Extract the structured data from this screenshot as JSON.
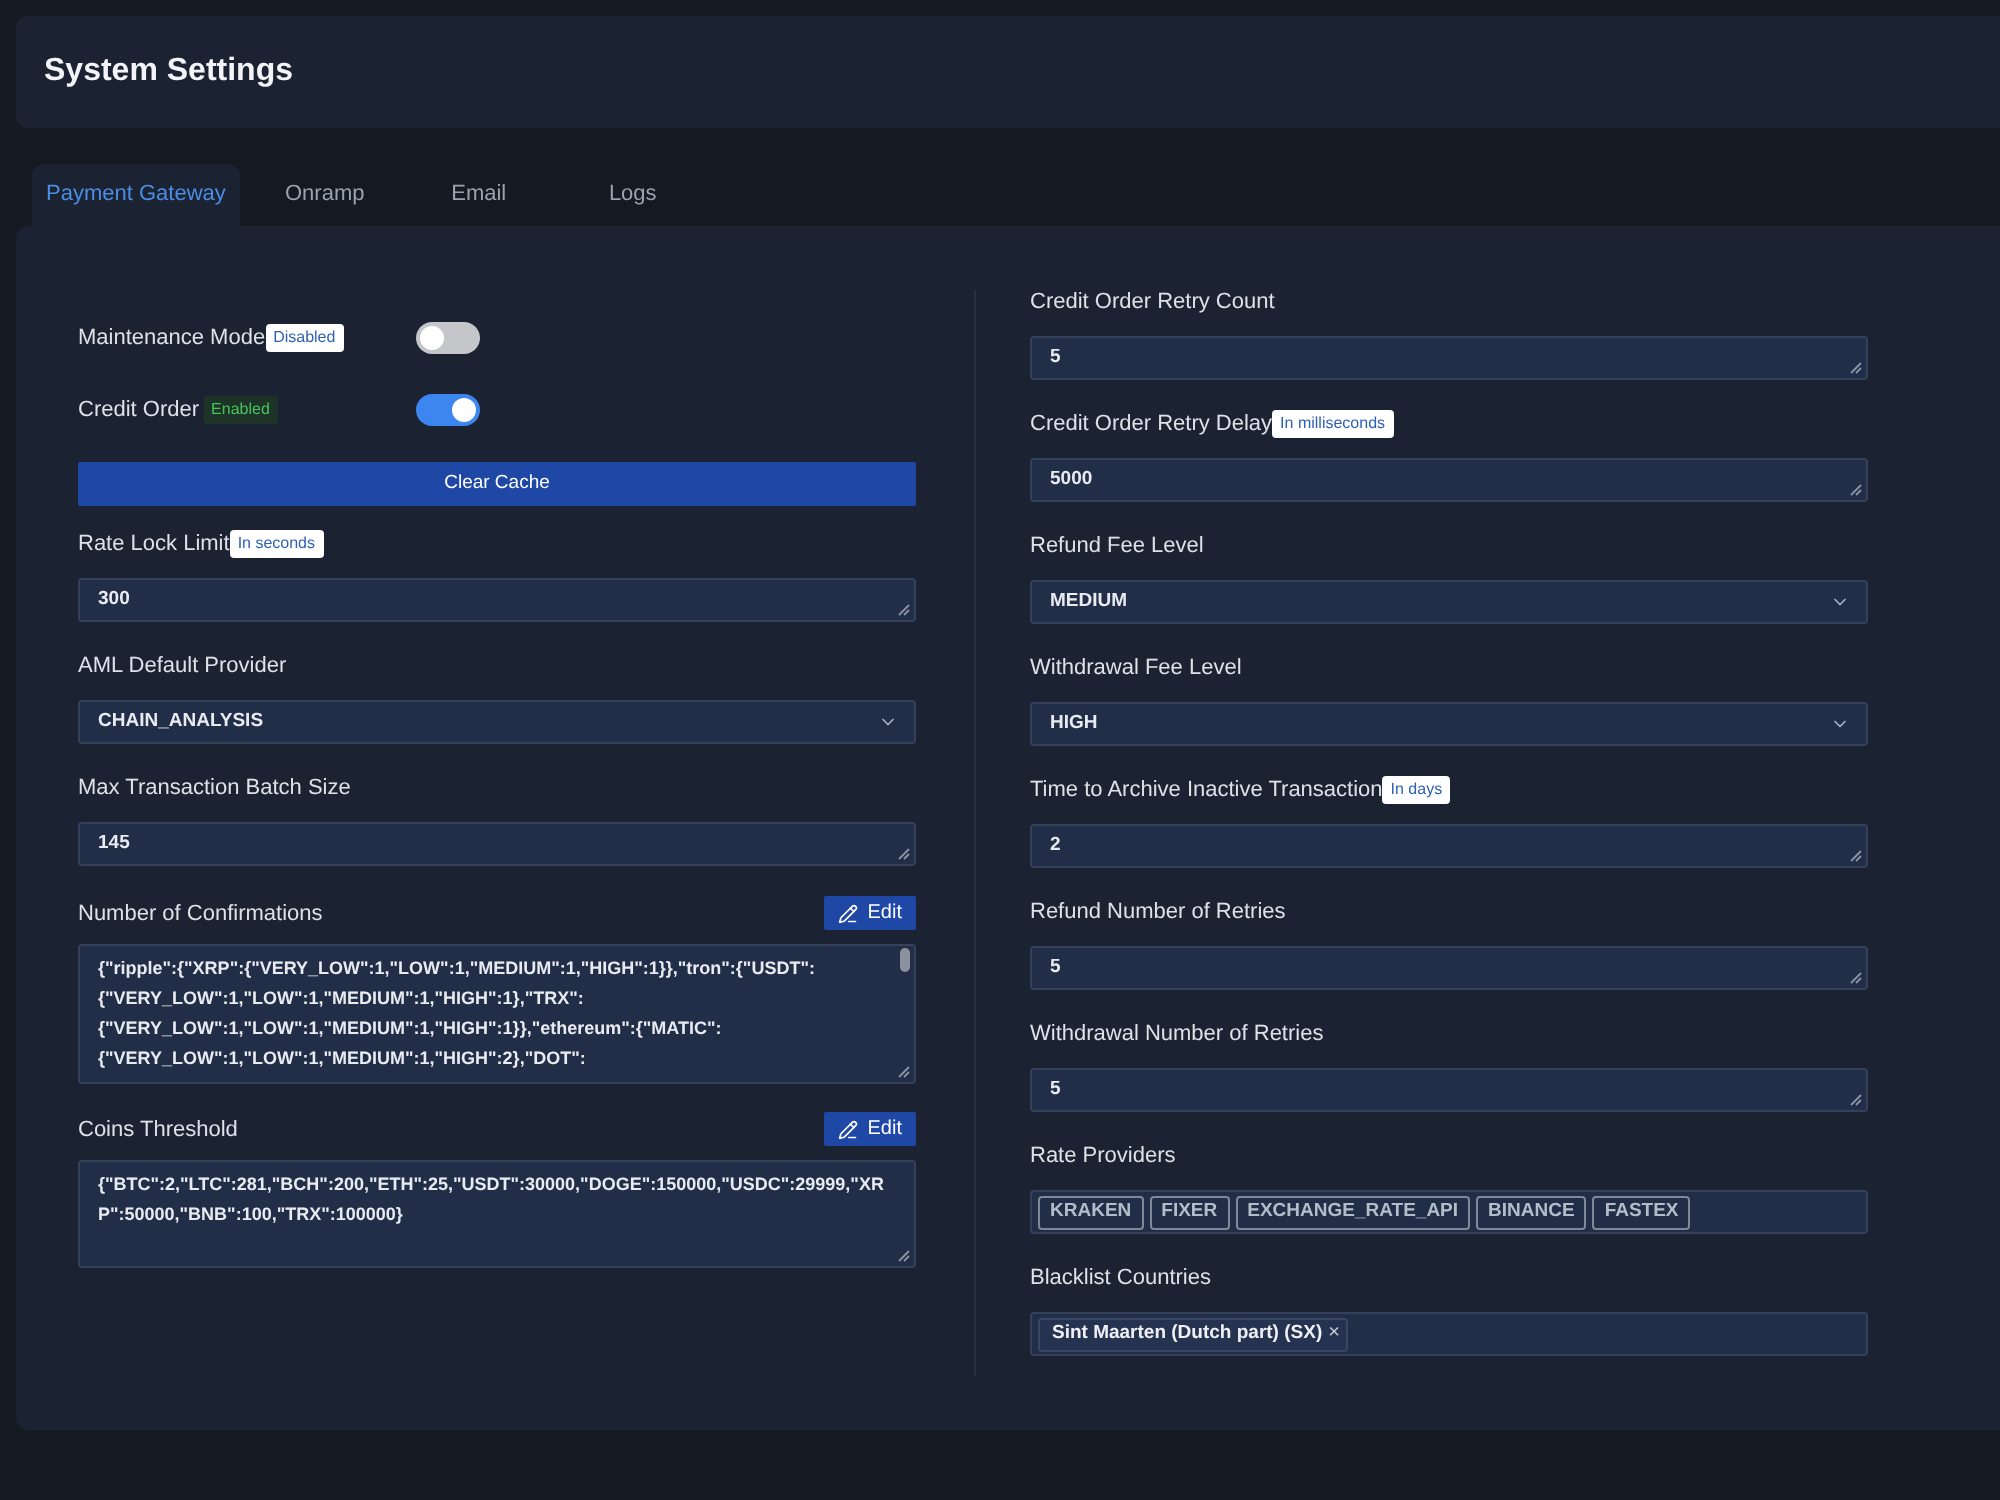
{
  "header": {
    "title": "System Settings"
  },
  "tabs": [
    {
      "label": "Payment Gateway",
      "selected": true
    },
    {
      "label": "Onramp",
      "selected": false
    },
    {
      "label": "Email",
      "selected": false
    },
    {
      "label": "Logs",
      "selected": false
    }
  ],
  "left_column": [
    {
      "kind": "toggle",
      "label": "Maintenance Mode",
      "badge": "Disabled",
      "on": false
    },
    {
      "kind": "toggle",
      "label": "Credit Order",
      "badge": "Enabled",
      "on": true
    },
    {
      "kind": "button",
      "label": "Clear Cache"
    },
    {
      "kind": "input",
      "label": "Rate Lock Limit",
      "hint": "In seconds",
      "value": "300"
    },
    {
      "kind": "select",
      "label": "AML Default Provider",
      "value": "CHAIN_ANALYSIS"
    },
    {
      "kind": "input",
      "label": "Max Transaction Batch Size",
      "value": "145"
    },
    {
      "kind": "json_editor",
      "label": "Number of Confirmations",
      "action": "Edit",
      "value": "{\"ripple\":{\"XRP\":{\"VERY_LOW\":1,\"LOW\":1,\"MEDIUM\":1,\"HIGH\":1}},\"tron\":{\"USDT\":{\"VERY_LOW\":1,\"LOW\":1,\"MEDIUM\":1,\"HIGH\":1},\"TRX\":{\"VERY_LOW\":1,\"LOW\":1,\"MEDIUM\":1,\"HIGH\":1}},\"ethereum\":{\"MATIC\":{\"VERY_LOW\":1,\"LOW\":1,\"MEDIUM\":1,\"HIGH\":2},\"DOT\":",
      "scrollable": true
    },
    {
      "kind": "json_editor",
      "label": "Coins Threshold",
      "action": "Edit",
      "value": "{\"BTC\":2,\"LTC\":281,\"BCH\":200,\"ETH\":25,\"USDT\":30000,\"DOGE\":150000,\"USDC\":29999,\"XRP\":50000,\"BNB\":100,\"TRX\":100000}",
      "scrollable": false
    }
  ],
  "right_column": [
    {
      "kind": "input",
      "label": "Credit Order Retry Count",
      "value": "5"
    },
    {
      "kind": "input",
      "label": "Credit Order Retry Delay",
      "hint": "In milliseconds",
      "value": "5000"
    },
    {
      "kind": "select",
      "label": "Refund Fee Level",
      "value": "MEDIUM"
    },
    {
      "kind": "select",
      "label": "Withdrawal Fee Level",
      "value": "HIGH"
    },
    {
      "kind": "input",
      "label": "Time to Archive Inactive Transaction",
      "hint": "In days",
      "value": "2"
    },
    {
      "kind": "input",
      "label": "Refund Number of Retries",
      "value": "5"
    },
    {
      "kind": "input",
      "label": "Withdrawal Number of Retries",
      "value": "5"
    },
    {
      "kind": "tags",
      "label": "Rate Providers",
      "tags": [
        {
          "text": "KRAKEN"
        },
        {
          "text": "FIXER"
        },
        {
          "text": "EXCHANGE_RATE_API"
        },
        {
          "text": "BINANCE"
        },
        {
          "text": "FASTEX"
        }
      ]
    },
    {
      "kind": "multiselect",
      "label": "Blacklist Countries",
      "tags": [
        {
          "text": "Sint Maarten (Dutch part) (SX)",
          "remove": "×"
        }
      ]
    }
  ]
}
